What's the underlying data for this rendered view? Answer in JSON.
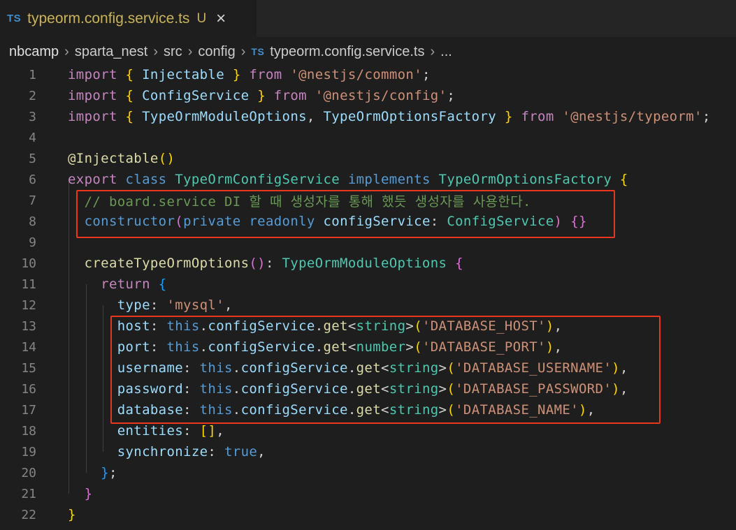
{
  "tab": {
    "lang_badge": "TS",
    "file_name": "typeorm.config.service.ts",
    "status": "U",
    "close_icon": "×"
  },
  "breadcrumb": {
    "items": [
      "nbcamp",
      "sparta_nest",
      "src",
      "config"
    ],
    "file_badge": "TS",
    "file": "typeorm.config.service.ts",
    "more": "..."
  },
  "colors": {
    "keyword": "#569cd6",
    "control": "#c586c0",
    "type": "#4ec9b0",
    "variable": "#9cdcfe",
    "function": "#dcdcaa",
    "string": "#ce9178",
    "comment": "#6a9955",
    "highlight_box": "#e8371c"
  },
  "lines": [
    {
      "n": "1",
      "segs": [
        [
          "kw2",
          "import"
        ],
        [
          "pun",
          " "
        ],
        [
          "b1",
          "{"
        ],
        [
          "pun",
          " "
        ],
        [
          "var",
          "Injectable"
        ],
        [
          "pun",
          " "
        ],
        [
          "b1",
          "}"
        ],
        [
          "pun",
          " "
        ],
        [
          "kw2",
          "from"
        ],
        [
          "pun",
          " "
        ],
        [
          "str",
          "'@nestjs/common'"
        ],
        [
          "pun",
          ";"
        ]
      ]
    },
    {
      "n": "2",
      "segs": [
        [
          "kw2",
          "import"
        ],
        [
          "pun",
          " "
        ],
        [
          "b1",
          "{"
        ],
        [
          "pun",
          " "
        ],
        [
          "var",
          "ConfigService"
        ],
        [
          "pun",
          " "
        ],
        [
          "b1",
          "}"
        ],
        [
          "pun",
          " "
        ],
        [
          "kw2",
          "from"
        ],
        [
          "pun",
          " "
        ],
        [
          "str",
          "'@nestjs/config'"
        ],
        [
          "pun",
          ";"
        ]
      ]
    },
    {
      "n": "3",
      "segs": [
        [
          "kw2",
          "import"
        ],
        [
          "pun",
          " "
        ],
        [
          "b1",
          "{"
        ],
        [
          "pun",
          " "
        ],
        [
          "var",
          "TypeOrmModuleOptions"
        ],
        [
          "pun",
          ", "
        ],
        [
          "var",
          "TypeOrmOptionsFactory"
        ],
        [
          "pun",
          " "
        ],
        [
          "b1",
          "}"
        ],
        [
          "pun",
          " "
        ],
        [
          "kw2",
          "from"
        ],
        [
          "pun",
          " "
        ],
        [
          "str",
          "'@nestjs/typeorm'"
        ],
        [
          "pun",
          ";"
        ]
      ]
    },
    {
      "n": "4",
      "segs": []
    },
    {
      "n": "5",
      "segs": [
        [
          "fn",
          "@Injectable"
        ],
        [
          "b1",
          "()"
        ]
      ]
    },
    {
      "n": "6",
      "segs": [
        [
          "kw2",
          "export"
        ],
        [
          "pun",
          " "
        ],
        [
          "kw",
          "class"
        ],
        [
          "pun",
          " "
        ],
        [
          "cls",
          "TypeOrmConfigService"
        ],
        [
          "pun",
          " "
        ],
        [
          "kw",
          "implements"
        ],
        [
          "pun",
          " "
        ],
        [
          "cls",
          "TypeOrmOptionsFactory"
        ],
        [
          "pun",
          " "
        ],
        [
          "b1",
          "{"
        ]
      ]
    },
    {
      "n": "7",
      "segs": [
        [
          "pun",
          "  "
        ],
        [
          "cmt",
          "// board.service DI 할 때 생성자를 통해 했듯 생성자를 사용한다."
        ]
      ]
    },
    {
      "n": "8",
      "segs": [
        [
          "pun",
          "  "
        ],
        [
          "kw",
          "constructor"
        ],
        [
          "b2",
          "("
        ],
        [
          "kw",
          "private"
        ],
        [
          "pun",
          " "
        ],
        [
          "kw",
          "readonly"
        ],
        [
          "pun",
          " "
        ],
        [
          "var",
          "configService"
        ],
        [
          "pun",
          ": "
        ],
        [
          "cls",
          "ConfigService"
        ],
        [
          "b2",
          ")"
        ],
        [
          "pun",
          " "
        ],
        [
          "b2",
          "{}"
        ]
      ]
    },
    {
      "n": "9",
      "segs": []
    },
    {
      "n": "10",
      "segs": [
        [
          "pun",
          "  "
        ],
        [
          "fn",
          "createTypeOrmOptions"
        ],
        [
          "b2",
          "()"
        ],
        [
          "pun",
          ": "
        ],
        [
          "cls",
          "TypeOrmModuleOptions"
        ],
        [
          "pun",
          " "
        ],
        [
          "b2",
          "{"
        ]
      ]
    },
    {
      "n": "11",
      "segs": [
        [
          "pun",
          "    "
        ],
        [
          "kw2",
          "return"
        ],
        [
          "pun",
          " "
        ],
        [
          "b3",
          "{"
        ]
      ]
    },
    {
      "n": "12",
      "segs": [
        [
          "pun",
          "      "
        ],
        [
          "var",
          "type"
        ],
        [
          "pun",
          ": "
        ],
        [
          "str",
          "'mysql'"
        ],
        [
          "pun",
          ","
        ]
      ]
    },
    {
      "n": "13",
      "segs": [
        [
          "pun",
          "      "
        ],
        [
          "var",
          "host"
        ],
        [
          "pun",
          ": "
        ],
        [
          "kw",
          "this"
        ],
        [
          "pun",
          "."
        ],
        [
          "var",
          "configService"
        ],
        [
          "pun",
          "."
        ],
        [
          "fn",
          "get"
        ],
        [
          "pun",
          "<"
        ],
        [
          "cls",
          "string"
        ],
        [
          "pun",
          ">"
        ],
        [
          "b1",
          "("
        ],
        [
          "str",
          "'DATABASE_HOST'"
        ],
        [
          "b1",
          ")"
        ],
        [
          "pun",
          ","
        ]
      ]
    },
    {
      "n": "14",
      "segs": [
        [
          "pun",
          "      "
        ],
        [
          "var",
          "port"
        ],
        [
          "pun",
          ": "
        ],
        [
          "kw",
          "this"
        ],
        [
          "pun",
          "."
        ],
        [
          "var",
          "configService"
        ],
        [
          "pun",
          "."
        ],
        [
          "fn",
          "get"
        ],
        [
          "pun",
          "<"
        ],
        [
          "cls",
          "number"
        ],
        [
          "pun",
          ">"
        ],
        [
          "b1",
          "("
        ],
        [
          "str",
          "'DATABASE_PORT'"
        ],
        [
          "b1",
          ")"
        ],
        [
          "pun",
          ","
        ]
      ]
    },
    {
      "n": "15",
      "segs": [
        [
          "pun",
          "      "
        ],
        [
          "var",
          "username"
        ],
        [
          "pun",
          ": "
        ],
        [
          "kw",
          "this"
        ],
        [
          "pun",
          "."
        ],
        [
          "var",
          "configService"
        ],
        [
          "pun",
          "."
        ],
        [
          "fn",
          "get"
        ],
        [
          "pun",
          "<"
        ],
        [
          "cls",
          "string"
        ],
        [
          "pun",
          ">"
        ],
        [
          "b1",
          "("
        ],
        [
          "str",
          "'DATABASE_USERNAME'"
        ],
        [
          "b1",
          ")"
        ],
        [
          "pun",
          ","
        ]
      ]
    },
    {
      "n": "16",
      "segs": [
        [
          "pun",
          "      "
        ],
        [
          "var",
          "password"
        ],
        [
          "pun",
          ": "
        ],
        [
          "kw",
          "this"
        ],
        [
          "pun",
          "."
        ],
        [
          "var",
          "configService"
        ],
        [
          "pun",
          "."
        ],
        [
          "fn",
          "get"
        ],
        [
          "pun",
          "<"
        ],
        [
          "cls",
          "string"
        ],
        [
          "pun",
          ">"
        ],
        [
          "b1",
          "("
        ],
        [
          "str",
          "'DATABASE_PASSWORD'"
        ],
        [
          "b1",
          ")"
        ],
        [
          "pun",
          ","
        ]
      ]
    },
    {
      "n": "17",
      "segs": [
        [
          "pun",
          "      "
        ],
        [
          "var",
          "database"
        ],
        [
          "pun",
          ": "
        ],
        [
          "kw",
          "this"
        ],
        [
          "pun",
          "."
        ],
        [
          "var",
          "configService"
        ],
        [
          "pun",
          "."
        ],
        [
          "fn",
          "get"
        ],
        [
          "pun",
          "<"
        ],
        [
          "cls",
          "string"
        ],
        [
          "pun",
          ">"
        ],
        [
          "b1",
          "("
        ],
        [
          "str",
          "'DATABASE_NAME'"
        ],
        [
          "b1",
          ")"
        ],
        [
          "pun",
          ","
        ]
      ]
    },
    {
      "n": "18",
      "segs": [
        [
          "pun",
          "      "
        ],
        [
          "var",
          "entities"
        ],
        [
          "pun",
          ": "
        ],
        [
          "b1",
          "[]"
        ],
        [
          "pun",
          ","
        ]
      ]
    },
    {
      "n": "19",
      "segs": [
        [
          "pun",
          "      "
        ],
        [
          "var",
          "synchronize"
        ],
        [
          "pun",
          ": "
        ],
        [
          "kw",
          "true"
        ],
        [
          "pun",
          ","
        ]
      ]
    },
    {
      "n": "20",
      "segs": [
        [
          "pun",
          "    "
        ],
        [
          "b3",
          "}"
        ],
        [
          "pun",
          ";"
        ]
      ]
    },
    {
      "n": "21",
      "segs": [
        [
          "pun",
          "  "
        ],
        [
          "b2",
          "}"
        ]
      ]
    },
    {
      "n": "22",
      "segs": [
        [
          "b1",
          "}"
        ]
      ]
    }
  ]
}
